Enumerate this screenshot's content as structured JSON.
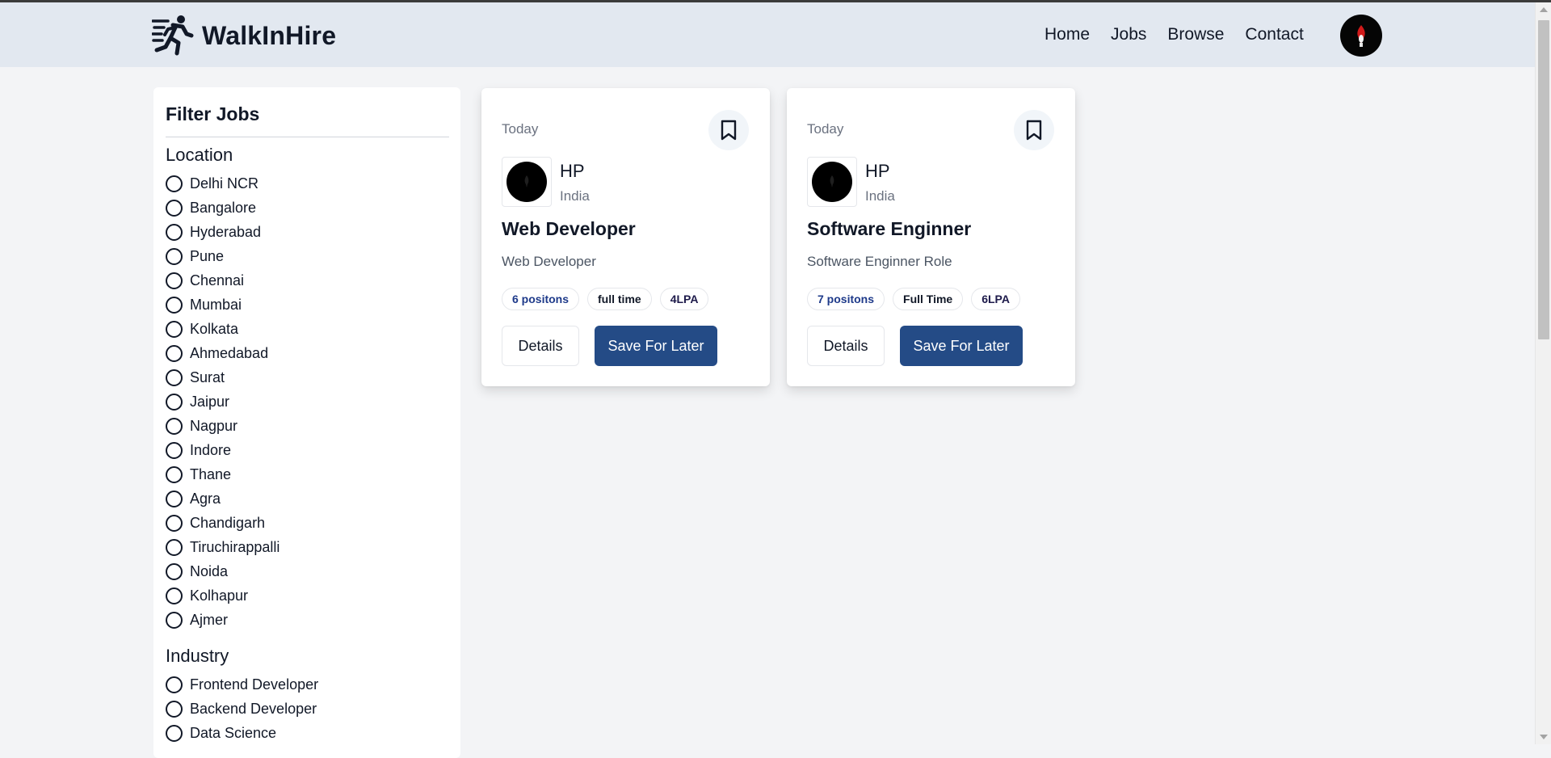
{
  "brand": {
    "name": "WalkInHire"
  },
  "nav": {
    "items": [
      {
        "label": "Home"
      },
      {
        "label": "Jobs"
      },
      {
        "label": "Browse"
      },
      {
        "label": "Contact"
      }
    ],
    "avatar_icon": "user-avatar-icon"
  },
  "filters": {
    "title": "Filter Jobs",
    "groups": [
      {
        "title": "Location",
        "options": [
          "Delhi NCR",
          "Bangalore",
          "Hyderabad",
          "Pune",
          "Chennai",
          "Mumbai",
          "Kolkata",
          "Ahmedabad",
          "Surat",
          "Jaipur",
          "Nagpur",
          "Indore",
          "Thane",
          "Agra",
          "Chandigarh",
          "Tiruchirappalli",
          "Noida",
          "Kolhapur",
          "Ajmer"
        ]
      },
      {
        "title": "Industry",
        "options": [
          "Frontend Developer",
          "Backend Developer",
          "Data Science"
        ]
      }
    ]
  },
  "jobs": [
    {
      "posted": "Today",
      "company": "HP",
      "country": "India",
      "title": "Web Developer",
      "description": "Web Developer",
      "badges": {
        "positions": "6 positons",
        "type": "full time",
        "salary": "4LPA"
      },
      "details_label": "Details",
      "save_label": "Save For Later"
    },
    {
      "posted": "Today",
      "company": "HP",
      "country": "India",
      "title": "Software Enginner",
      "description": "Software Enginner Role",
      "badges": {
        "positions": "7 positons",
        "type": "Full Time",
        "salary": "6LPA"
      },
      "details_label": "Details",
      "save_label": "Save For Later"
    }
  ],
  "colors": {
    "navbar_bg": "#e2e8f0",
    "page_bg": "#f3f4f6",
    "primary_button": "#244b86",
    "positions_badge_text": "#1e3a8a"
  }
}
